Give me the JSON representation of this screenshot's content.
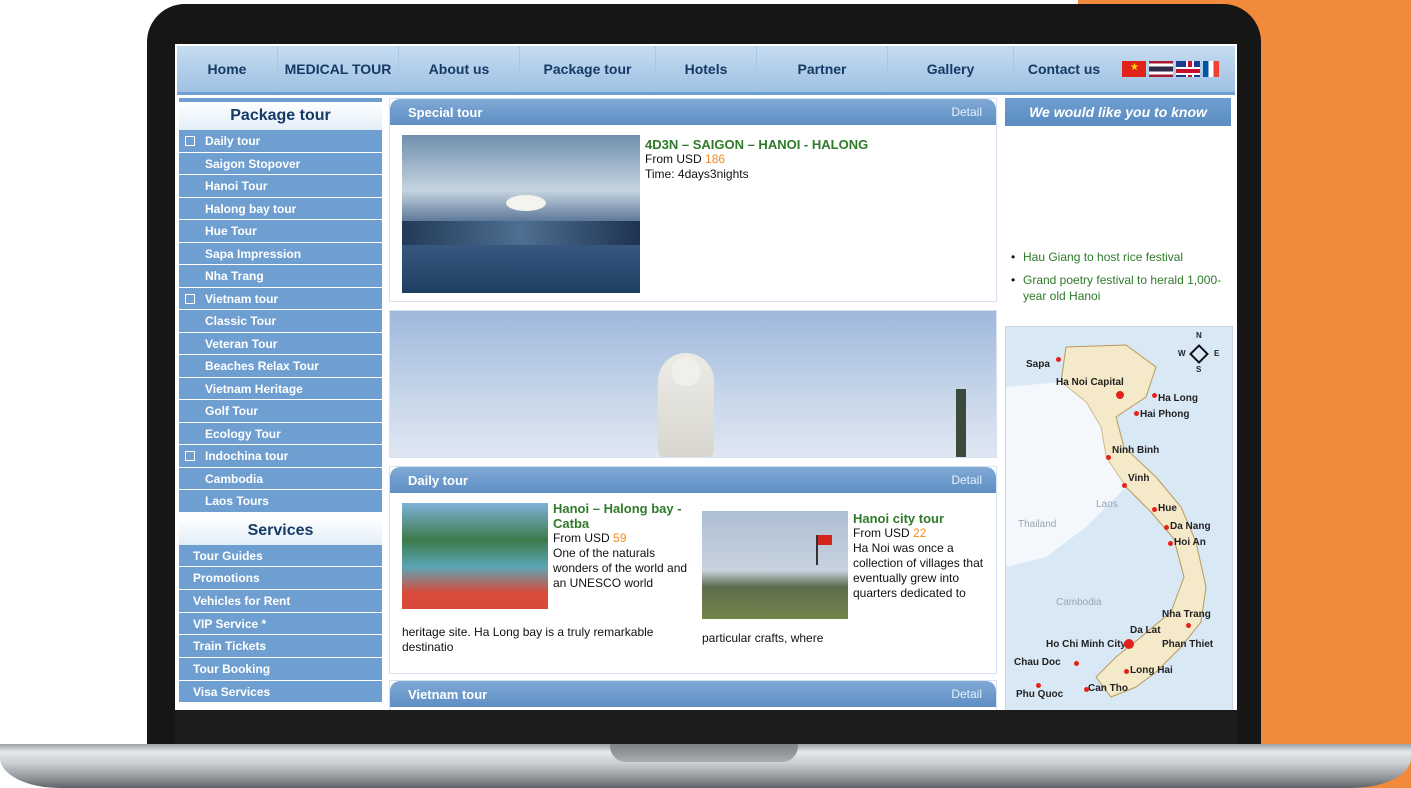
{
  "nav": {
    "items": [
      "Home",
      "MEDICAL TOUR",
      "About us",
      "Package tour",
      "Hotels",
      "Partner",
      "Gallery",
      "Contact us"
    ]
  },
  "sidebar": {
    "package_title": "Package tour",
    "package_items": [
      {
        "label": "Daily tour",
        "group": true
      },
      {
        "label": "Saigon Stopover",
        "group": false
      },
      {
        "label": "Hanoi Tour",
        "group": false
      },
      {
        "label": "Halong bay tour",
        "group": false
      },
      {
        "label": "Hue Tour",
        "group": false
      },
      {
        "label": "Sapa Impression",
        "group": false
      },
      {
        "label": "Nha Trang",
        "group": false
      },
      {
        "label": "Vietnam tour",
        "group": true
      },
      {
        "label": "Classic Tour",
        "group": false
      },
      {
        "label": "Veteran Tour",
        "group": false
      },
      {
        "label": "Beaches Relax Tour",
        "group": false
      },
      {
        "label": "Vietnam Heritage",
        "group": false
      },
      {
        "label": "Golf Tour",
        "group": false
      },
      {
        "label": "Ecology Tour",
        "group": false
      },
      {
        "label": "Indochina tour",
        "group": true
      },
      {
        "label": "Cambodia",
        "group": false
      },
      {
        "label": "Laos Tours",
        "group": false
      }
    ],
    "services_title": "Services",
    "services_items": [
      "Tour Guides",
      "Promotions",
      "Vehicles for Rent",
      "VIP Service *",
      "Train Tickets",
      "Tour Booking",
      "Visa Services"
    ]
  },
  "special_tour": {
    "header": "Special tour",
    "detail": "Detail",
    "title": "4D3N – SAIGON – HANOI - HALONG",
    "from_label": "From USD",
    "price": "186",
    "time": "Time: 4days3nights"
  },
  "daily_tour": {
    "header": "Daily tour",
    "detail": "Detail",
    "tours": [
      {
        "title": "Hanoi – Halong bay -Catba",
        "from_label": "From USD",
        "price": "59",
        "desc_side": "One of the naturals wonders of the world and an UNESCO world",
        "desc_bottom": "heritage site. Ha Long bay is a truly remarkable destinatio"
      },
      {
        "title": "Hanoi city tour",
        "from_label": "From USD",
        "price": "22",
        "desc_side": "Ha Noi was once a collection of villages that eventually grew into quarters dedicated to",
        "desc_bottom": "particular crafts, where"
      }
    ]
  },
  "vietnam_tour": {
    "header": "Vietnam tour",
    "detail": "Detail"
  },
  "right": {
    "know_header": "We would like you to know",
    "news": [
      "Hau Giang to host rice festival",
      "Grand poetry festival to herald 1,000-year old Hanoi"
    ]
  },
  "map": {
    "labels": [
      "Sapa",
      "Ha Noi Capital",
      "Ha Long",
      "Hai Phong",
      "Ninh Binh",
      "Vinh",
      "Laos",
      "Thailand",
      "Hue",
      "Da Nang",
      "Hoi An",
      "Cambodia",
      "Nha Trang",
      "Da Lat",
      "Ho Chi Minh City",
      "Phan Thiet",
      "Chau Doc",
      "Long Hai",
      "Phu Quoc",
      "Can Tho"
    ],
    "compass": {
      "n": "N",
      "s": "S",
      "e": "E",
      "w": "W"
    }
  },
  "colors": {
    "accent_blue": "#6f9fd0",
    "title_green": "#2f7a2a",
    "price_orange": "#f08a1c",
    "background_orange": "#f28a3b"
  }
}
